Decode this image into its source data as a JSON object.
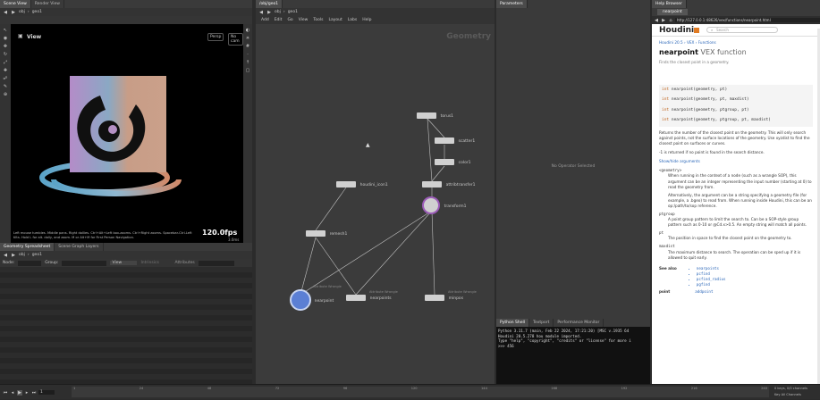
{
  "colors": {
    "accent": "#e07b24",
    "viewport_bg": "#000000",
    "network_bg": "#3b3b3b",
    "help_bg": "#ffffff",
    "houdini_orange": "#e07b24",
    "link": "#2a66b8"
  },
  "top_tabs": {
    "scene_view": "Scene View",
    "render_view": "Render View",
    "network_path": "/obj/geo1",
    "parameters": "Parameters",
    "help_browser": "Help Browser"
  },
  "path": {
    "obj": "obj",
    "geo": "geo1"
  },
  "viewport": {
    "title": "View",
    "persp": "Persp",
    "no_cam": "No cam",
    "fps": "120.0fps",
    "ms": "3.0ms",
    "hint": "Left mouse tumbles. Middle pans. Right dollies. Ctrl+Alt+Left box-zooms. Ctrl+Right zooms. Spacebar-Ctrl-Left tilts. Hold L for alt. dolly, and zoom. M or Alt+M for First Person Navigation."
  },
  "spreadsheet": {
    "tab1": "Geometry Spreadsheet",
    "tab2": "Scene Graph Layers",
    "node_label": "Node:",
    "group_label": "Group:",
    "view_label": "View",
    "intrinsics": "Intrinsics",
    "attributes": "Attributes"
  },
  "network": {
    "menu": [
      "Add",
      "Edit",
      "Go",
      "View",
      "Tools",
      "Layout",
      "Labs",
      "Help"
    ],
    "context": "Geometry",
    "nodes": [
      {
        "name": "torus1",
        "sub": ""
      },
      {
        "name": "scatter1",
        "sub": ""
      },
      {
        "name": "color1",
        "sub": ""
      },
      {
        "name": "houdini_icon1",
        "sub": ""
      },
      {
        "name": "attribtransfer1",
        "sub": ""
      },
      {
        "name": "transform1",
        "sub": ""
      },
      {
        "name": "remesh1",
        "sub": ""
      },
      {
        "name": "nearpoint",
        "sub": "Attribute Wrangle"
      },
      {
        "name": "nearpoints",
        "sub": "Attribute Wrangle"
      },
      {
        "name": "minpos",
        "sub": "Attribute Wrangle"
      }
    ]
  },
  "parameters": {
    "empty": "No Operator Selected"
  },
  "python": {
    "tab1": "Python Shell",
    "tab2": "Textport",
    "tab3": "Performance Monitor",
    "lines": [
      "Python 3.11.7 (main, Feb 22 2024, 17:21:20) [MSC v.1935 64",
      "Houdini 20.5.278 hou module imported.",
      "Type \"help\", \"copyright\", \"credits\" or \"license\" for more i",
      ">>> 456"
    ]
  },
  "help": {
    "tab": "nearpoint",
    "url": "http://127.0.0.1:48626/vex/functions/nearpoint.html",
    "logo": "Houdini",
    "search_placeholder": "Search",
    "breadcrumb": [
      "Houdini 20.5",
      "VEX",
      "Functions"
    ],
    "title": "nearpoint",
    "title_suffix": "VEX function",
    "subtitle": "Finds the closest point in a geometry.",
    "signatures": [
      {
        "type": "int",
        "sig": "nearpoint(geometry, pt)"
      },
      {
        "type": "int",
        "sig": "nearpoint(geometry, pt, maxdist)"
      },
      {
        "type": "int",
        "sig": "nearpoint(geometry, ptgroup, pt)"
      },
      {
        "type": "int",
        "sig": "nearpoint(geometry, ptgroup, pt, maxdist)"
      }
    ],
    "desc1": "Returns the number of the closest point on the geometry. This will only search against points, not the surface locations of the geometry. Use xyzdist to find the closest point on surfaces or curves.",
    "desc2": "-1 is returned if no point is found in the search distance.",
    "showhide": "Show/hide arguments",
    "args": [
      {
        "name": "<geometry>",
        "text": "When running in the context of a node (such as a wrangle SOP), this argument can be an integer representing the input number (starting at 0) to read the geometry from."
      },
      {
        "name": "",
        "text": "Alternatively, the argument can be a string specifying a geometry file (for example, a .bgeo) to read from. When running inside Houdini, this can be an op:/path/to/sop reference."
      },
      {
        "name": "ptgroup",
        "text": "A point group pattern to limit the search to. Can be a SOP-style group pattern such as 0-10 or @Cd.x>0.5. An empty string will match all points."
      },
      {
        "name": "pt",
        "text": "The position in space to find the closest point on the geometry to."
      },
      {
        "name": "maxdist",
        "text": "The maximum distance to search. The operation can be sped up if it is allowed to quit early."
      }
    ],
    "see_also_label": "See also",
    "see_also": [
      "nearpoints",
      "pcfind",
      "pcfind_radius",
      "pgfind"
    ],
    "point_label": "point",
    "addpoint": "addpoint"
  },
  "timeline": {
    "frame": "1",
    "ticks": [
      "1",
      "24",
      "48",
      "72",
      "96",
      "120",
      "144",
      "168",
      "192",
      "216",
      "240"
    ],
    "end1": "240",
    "end2": "240",
    "keys": "0 keys, 0/0 channels",
    "key_all": "Key All Channels",
    "auto_update": "Auto Update"
  }
}
